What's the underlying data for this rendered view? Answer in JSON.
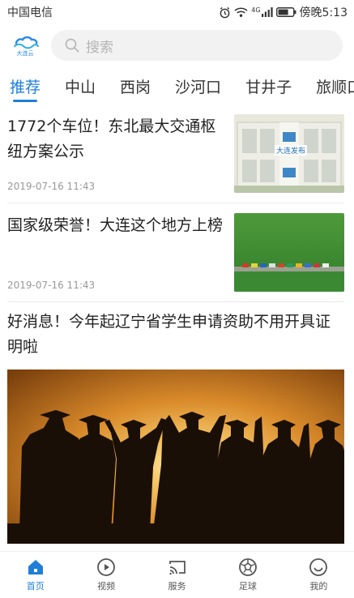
{
  "status_bar": {
    "carrier": "中国电信",
    "network": "4G",
    "time": "傍晚5:13",
    "icons": [
      "alarm-icon",
      "wifi-icon",
      "signal-icon",
      "battery-icon"
    ]
  },
  "header": {
    "logo_text": "大连云",
    "search_placeholder": "搜索"
  },
  "tabs": [
    "推荐",
    "中山",
    "西岗",
    "沙河口",
    "甘井子",
    "旅顺口"
  ],
  "active_tab": "推荐",
  "news": [
    {
      "title": "1772个车位！东北最大交通枢纽方案公示",
      "date": "2019-07-16 11:43",
      "thumb_label": "大连发布"
    },
    {
      "title": "国家级荣誉！大连这个地方上榜",
      "date": "2019-07-16 11:43"
    }
  ],
  "featured": {
    "title": "好消息！今年起辽宁省学生申请资助不用开具证明啦"
  },
  "bottom_nav": [
    {
      "label": "首页",
      "icon": "home-icon",
      "active": true
    },
    {
      "label": "视频",
      "icon": "play-icon",
      "active": false
    },
    {
      "label": "服务",
      "icon": "cast-icon",
      "active": false
    },
    {
      "label": "足球",
      "icon": "soccer-ball-icon",
      "active": false
    },
    {
      "label": "我的",
      "icon": "smile-icon",
      "active": false
    }
  ],
  "colors": {
    "accent": "#1f7fd8",
    "text": "#222222",
    "muted": "#999999"
  }
}
